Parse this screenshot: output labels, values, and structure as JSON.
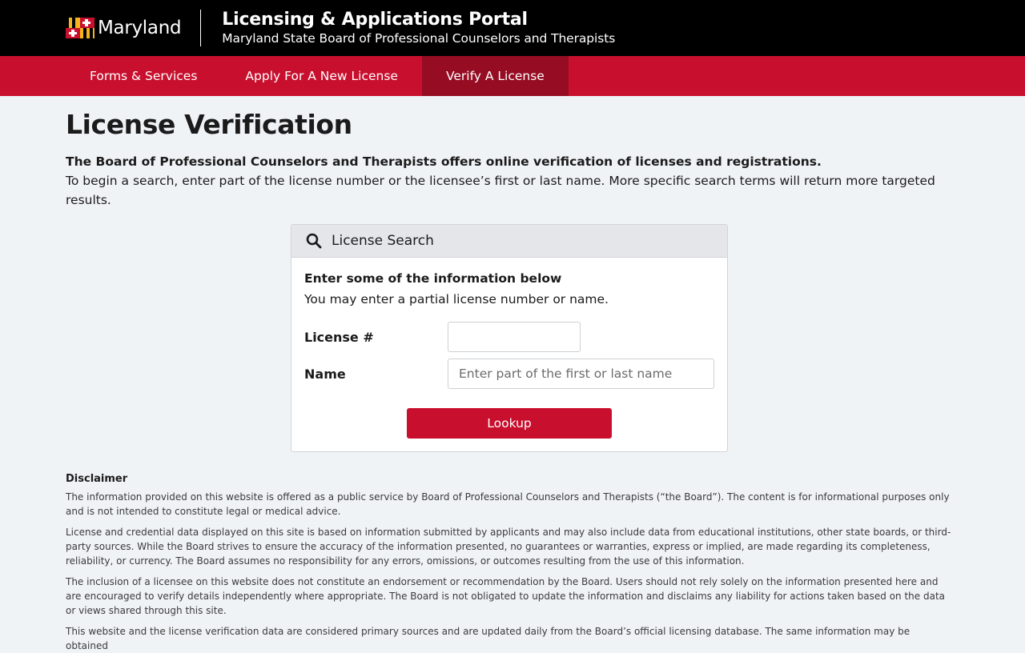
{
  "header": {
    "logo_text": "Maryland",
    "portal_title": "Licensing & Applications Portal",
    "portal_subtitle": "Maryland State Board of Professional Counselors and Therapists"
  },
  "nav": {
    "items": [
      {
        "label": "Forms & Services",
        "active": false
      },
      {
        "label": "Apply For A New License",
        "active": false
      },
      {
        "label": "Verify A License",
        "active": true
      }
    ]
  },
  "main": {
    "title": "License Verification",
    "intro_bold": "The Board of Professional Counselors and Therapists offers online verification of licenses and registrations.",
    "intro_text": "To begin a search, enter part of the license number or the licensee’s first or last name. More specific search terms will return more targeted results."
  },
  "search": {
    "header_icon": "search-icon",
    "title": "License Search",
    "hint_bold": "Enter some of the information below",
    "hint": "You may enter a partial license number or name.",
    "license_label": "License #",
    "license_value": "",
    "license_placeholder": "",
    "name_label": "Name",
    "name_value": "",
    "name_placeholder": "Enter part of the first or last name",
    "button_label": "Lookup"
  },
  "disclaimer": {
    "title": "Disclaimer",
    "paragraphs": [
      "The information provided on this website is offered as a public service by Board of Professional Counselors and Therapists (“the Board”). The content is for informational purposes only and is not intended to constitute legal or medical advice.",
      "License and credential data displayed on this site is based on information submitted by applicants and may also include data from educational institutions, other state boards, or third-party sources. While the Board strives to ensure the accuracy of the information presented, no guarantees or warranties, express or implied, are made regarding its completeness, reliability, or currency. The Board assumes no responsibility for any errors, omissions, or outcomes resulting from the use of this information.",
      "The inclusion of a licensee on this website does not constitute an endorsement or recommendation by the Board. Users should not rely solely on the information presented here and are encouraged to verify details independently where appropriate. The Board is not obligated to update the information and disclaims any liability for actions taken based on the data or views shared through this site.",
      "This website and the license verification data are considered primary sources and are updated daily from the Board’s official licensing database. The same information may be obtained"
    ]
  },
  "colors": {
    "header_bg": "#000000",
    "nav_bg": "#c8102e",
    "nav_active_bg": "#960d23",
    "button_bg": "#c8102e",
    "page_bg": "#f0f3f6"
  }
}
